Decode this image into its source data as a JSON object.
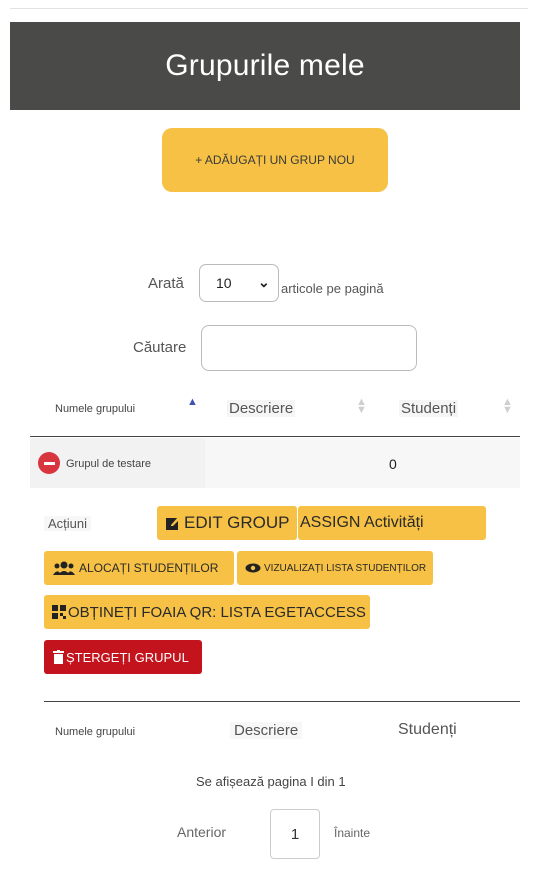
{
  "header": {
    "title": "Grupurile mele"
  },
  "add_group_button": "+ ADĂUGAȚI UN GRUP NOU",
  "show": {
    "label": "Arată",
    "value": "10",
    "suffix": "articole pe pagină"
  },
  "search": {
    "label": "Căutare",
    "placeholder": ""
  },
  "table": {
    "columns": [
      "Numele grupului",
      "Descriere",
      "Studenți"
    ],
    "rows": [
      {
        "name": "Grupul de testare",
        "description": "",
        "students": "0"
      }
    ],
    "footer_columns": [
      "Numele grupului",
      "Descriere",
      "Studenți"
    ]
  },
  "actions": {
    "label": "Acțiuni",
    "edit_group": "EDIT GROUP",
    "assign_activities": "ASSIGN Activități",
    "assign_students": "ALOCAȚI STUDENȚILOR",
    "view_students": "VIZUALIZAȚI LISTA STUDENȚILOR",
    "qr_sheet": "OBȚINEȚI FOAIA QR: LISTA EGETACCESS",
    "delete_group": "ȘTERGEȚI GRUPUL"
  },
  "pagination": {
    "info": "Se afișează pagina I din 1",
    "previous": "Anterior",
    "current_page": "1",
    "next": "Înainte"
  },
  "colors": {
    "header_bg": "#4a4a48",
    "accent_yellow": "#f6c144",
    "danger_red": "#c3131c"
  }
}
